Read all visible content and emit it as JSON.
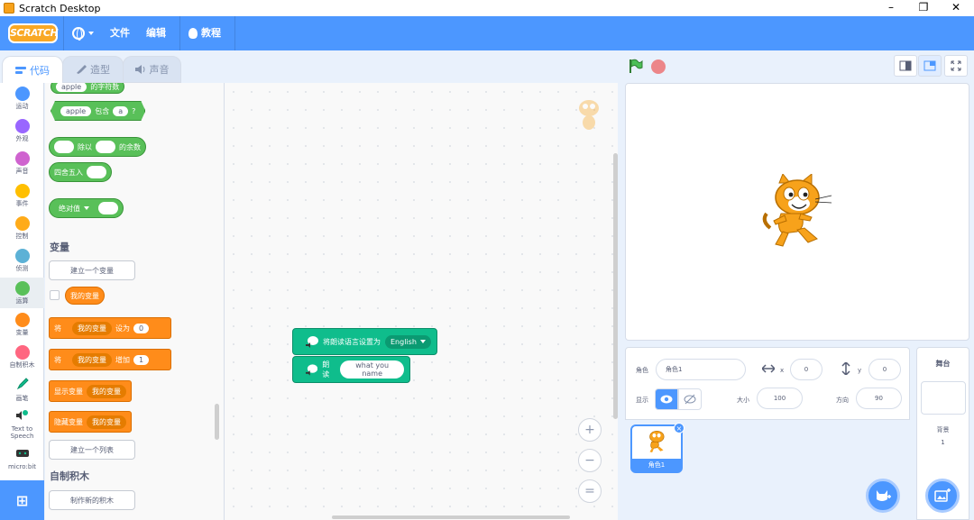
{
  "window": {
    "title": "Scratch Desktop",
    "minimize": "–",
    "maximize": "❐",
    "close": "✕"
  },
  "menubar": {
    "logo": "SCRATCH",
    "file": "文件",
    "edit": "编辑",
    "tutorial": "教程"
  },
  "tabs": {
    "code": "代码",
    "costumes": "造型",
    "sounds": "声音"
  },
  "categories": [
    {
      "label": "运动",
      "color": "#4c97ff"
    },
    {
      "label": "外观",
      "color": "#9966ff"
    },
    {
      "label": "声音",
      "color": "#cf63cf"
    },
    {
      "label": "事件",
      "color": "#ffbf00"
    },
    {
      "label": "控制",
      "color": "#ffab19"
    },
    {
      "label": "侦测",
      "color": "#5cb1d6"
    },
    {
      "label": "运算",
      "color": "#59c059"
    },
    {
      "label": "变量",
      "color": "#ff8c1a"
    },
    {
      "label": "自制积木",
      "color": "#ff6680"
    },
    {
      "label": "画笔",
      "color": "#0fbd8c"
    },
    {
      "label": "Text to Speech",
      "color": "#0fbd8c"
    },
    {
      "label": "micro:bit",
      "color": "#0fbd8c"
    }
  ],
  "palette": {
    "length_of": {
      "arg": "apple",
      "text": "的字符数"
    },
    "contains": {
      "arg1": "apple",
      "text": "包含",
      "arg2": "a",
      "q": "?"
    },
    "mod": {
      "text1": "除以",
      "text2": "的余数"
    },
    "round": {
      "text": "四舍五入"
    },
    "abs": {
      "text": "绝对值"
    },
    "variables_title": "变量",
    "make_variable": "建立一个变量",
    "my_variable": "我的变量",
    "set_var": {
      "t1": "将",
      "var": "我的变量",
      "t2": "设为",
      "val": "0"
    },
    "change_var": {
      "t1": "将",
      "var": "我的变量",
      "t2": "增加",
      "val": "1"
    },
    "show_var": {
      "t1": "显示变量",
      "var": "我的变量"
    },
    "hide_var": {
      "t1": "隐藏变量",
      "var": "我的变量"
    },
    "make_list": "建立一个列表",
    "my_blocks_title": "自制积木",
    "make_block": "制作新的积木"
  },
  "code": {
    "set_language": {
      "text": "将朗读语言设置为",
      "value": "English"
    },
    "speak": {
      "text": "朗读",
      "value": "what you name"
    },
    "zoom_in": "+",
    "zoom_out": "−",
    "zoom_reset": "="
  },
  "sprite_info": {
    "sprite_label": "角色",
    "sprite_name": "角色1",
    "x_label": "x",
    "x": "0",
    "y_label": "y",
    "y": "0",
    "show_label": "显示",
    "size_label": "大小",
    "size": "100",
    "direction_label": "方向",
    "direction": "90"
  },
  "sprites": [
    {
      "name": "角色1"
    }
  ],
  "stage_pane": {
    "title": "舞台",
    "backdrops_label": "背景",
    "backdrops_count": "1"
  }
}
